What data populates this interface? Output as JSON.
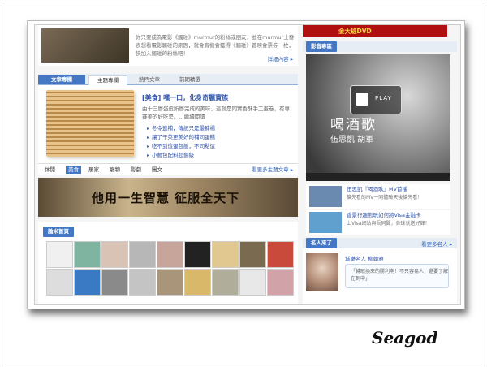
{
  "intro": {
    "text": "你只要成為電影《觸碰》murmur的粉絲或朋友，並在murmur上發表想看電影觸碰的原因，就會有機會獲得《觸碰》首映會票券一枚，快加入觸碰的粉絲吧！",
    "more": "詳細內容 ▸"
  },
  "tabs": [
    "文章專欄",
    "主題專欄",
    "熱門文章",
    "前期精選"
  ],
  "article": {
    "title": "[美食] 嘿一口，化身奇麗寶族",
    "desc": "由十三層蛋皮所層完成的美味，這就是同實香酥手工蛋卷，有專賽美的好吃是。...繼續閱讀",
    "links": [
      "冬令進補，傳統只是最補楊",
      "讓了干菜更美好的補同蛋糕",
      "吃不到這蛋包飯，不同點這",
      "小麵包配料超藝級"
    ]
  },
  "categories": [
    "休閒",
    "美食",
    "居家",
    "寵物",
    "影劇",
    "圖文"
  ],
  "categories_more": "看更多主題文章 ▸",
  "banner": {
    "text": "他用一生智慧 征服全天下"
  },
  "photos_head": "論米首頁",
  "right": {
    "dvd": "金大班DVD",
    "video_head": "影音專區",
    "video_title": "喝酒歌",
    "video_sub": "伍思凱 胡軍",
    "play": "PLAY",
    "videos": [
      {
        "title": "伍思凱『喝酒歌』MV首播",
        "desc": "搶先看的MV一同體驗天後搶先看！"
      },
      {
        "title": "香景行趣熊玩如何將Visa金融卡",
        "desc": "上Visa網站與吾同聞，各球就送好鋒！"
      }
    ],
    "star_head": "名人來了",
    "star_more": "看更多名人 ▸",
    "star_name": "城樂名人 柳翰雅",
    "star_text": "「轉眼換來的勝利啊！不只容易人，還要了解在到中」"
  },
  "signature": "Seagod"
}
